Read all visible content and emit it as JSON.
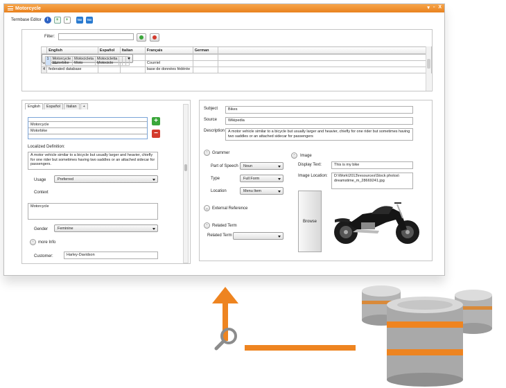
{
  "window": {
    "title": "Motorcycle",
    "controls": {
      "pin": "▾",
      "restore": "▫",
      "close": "X"
    }
  },
  "toolbar": {
    "label": "Termbase Editor",
    "tbx1": "TBX",
    "tbx2": "TBX"
  },
  "filter": {
    "label": "Filter:",
    "value": ""
  },
  "grid": {
    "columns": [
      "English",
      "Español",
      "Italian",
      "Français",
      "German"
    ],
    "rows": [
      {
        "num": "1",
        "english": "Motorcycle\nMotorbike",
        "espanol": "Motocicleta\nMoto",
        "italian": "Motocicletta\nMotociclo",
        "francais": "",
        "german": ""
      },
      {
        "num": "2",
        "english": "bicycles",
        "espanol": "bicicletas",
        "italian": "",
        "francais": "",
        "german": ""
      },
      {
        "num": "3",
        "english": "email",
        "espanol": "",
        "italian": "",
        "francais": "Courriel",
        "german": ""
      },
      {
        "num": "4",
        "english": "federated database",
        "espanol": "",
        "italian": "",
        "francais": "base de données fédérée",
        "german": ""
      }
    ]
  },
  "entry": {
    "tabs": [
      "English",
      "Español",
      "Italian",
      "+"
    ],
    "terms": [
      "Motorcycle",
      "Motorbike"
    ],
    "localized_definition_label": "Localized Definition:",
    "localized_definition": "A motor vehicle similar to a bicycle but usually larger and heavier, chiefly for one rider but sometimes having two saddles or an attached sidecar for passengers.",
    "usage_label": "Usage",
    "usage_value": "Preferred",
    "context_label": "Context",
    "context_value": "Motorcycle",
    "gender_label": "Gender",
    "gender_value": "Feminine",
    "more_info_label": "more Info",
    "customer_label": "Customer:",
    "customer_value": "Harley-Davidson"
  },
  "concept": {
    "subject_label": "Subject",
    "subject_value": "Bikes",
    "source_label": "Source",
    "source_value": "Wikipedia",
    "description_label": "Description",
    "description_value": "A motor vehicle similar to a bicycle but usually larger and heavier, chiefly for one rider but sometimes having two saddles or an attached sidecar for passengers",
    "grammar_label": "Grammer",
    "pos_label": "Part of Speech",
    "pos_value": "Noun",
    "type_label": "Type",
    "type_value": "Full Form",
    "location_label": "Location",
    "location_value": "Menu Item",
    "external_reference_label": "External Reference",
    "related_term_section_label": "Related Term",
    "related_term_label": "Related Term",
    "related_term_value": "",
    "image_label": "Image",
    "display_text_label": "Display Text:",
    "display_text_value": "This is my bike",
    "image_location_label": "Image Location:",
    "image_location_value": "D:\\Work\\2013\\resources\\Stock photos\\ dreamstime_m_28669241.jpg",
    "browse_label": "Browse"
  },
  "colors": {
    "accent": "#f08a24",
    "add_green": "#3aa63a",
    "remove_red": "#d33a2c"
  },
  "icons": [
    "menu-icon",
    "info-icon",
    "add-entry-icon",
    "new-document-icon",
    "tbx-import-icon",
    "tbx-export-icon",
    "search-icon",
    "database-icon",
    "arrow-up-icon",
    "motorcycle-image"
  ]
}
